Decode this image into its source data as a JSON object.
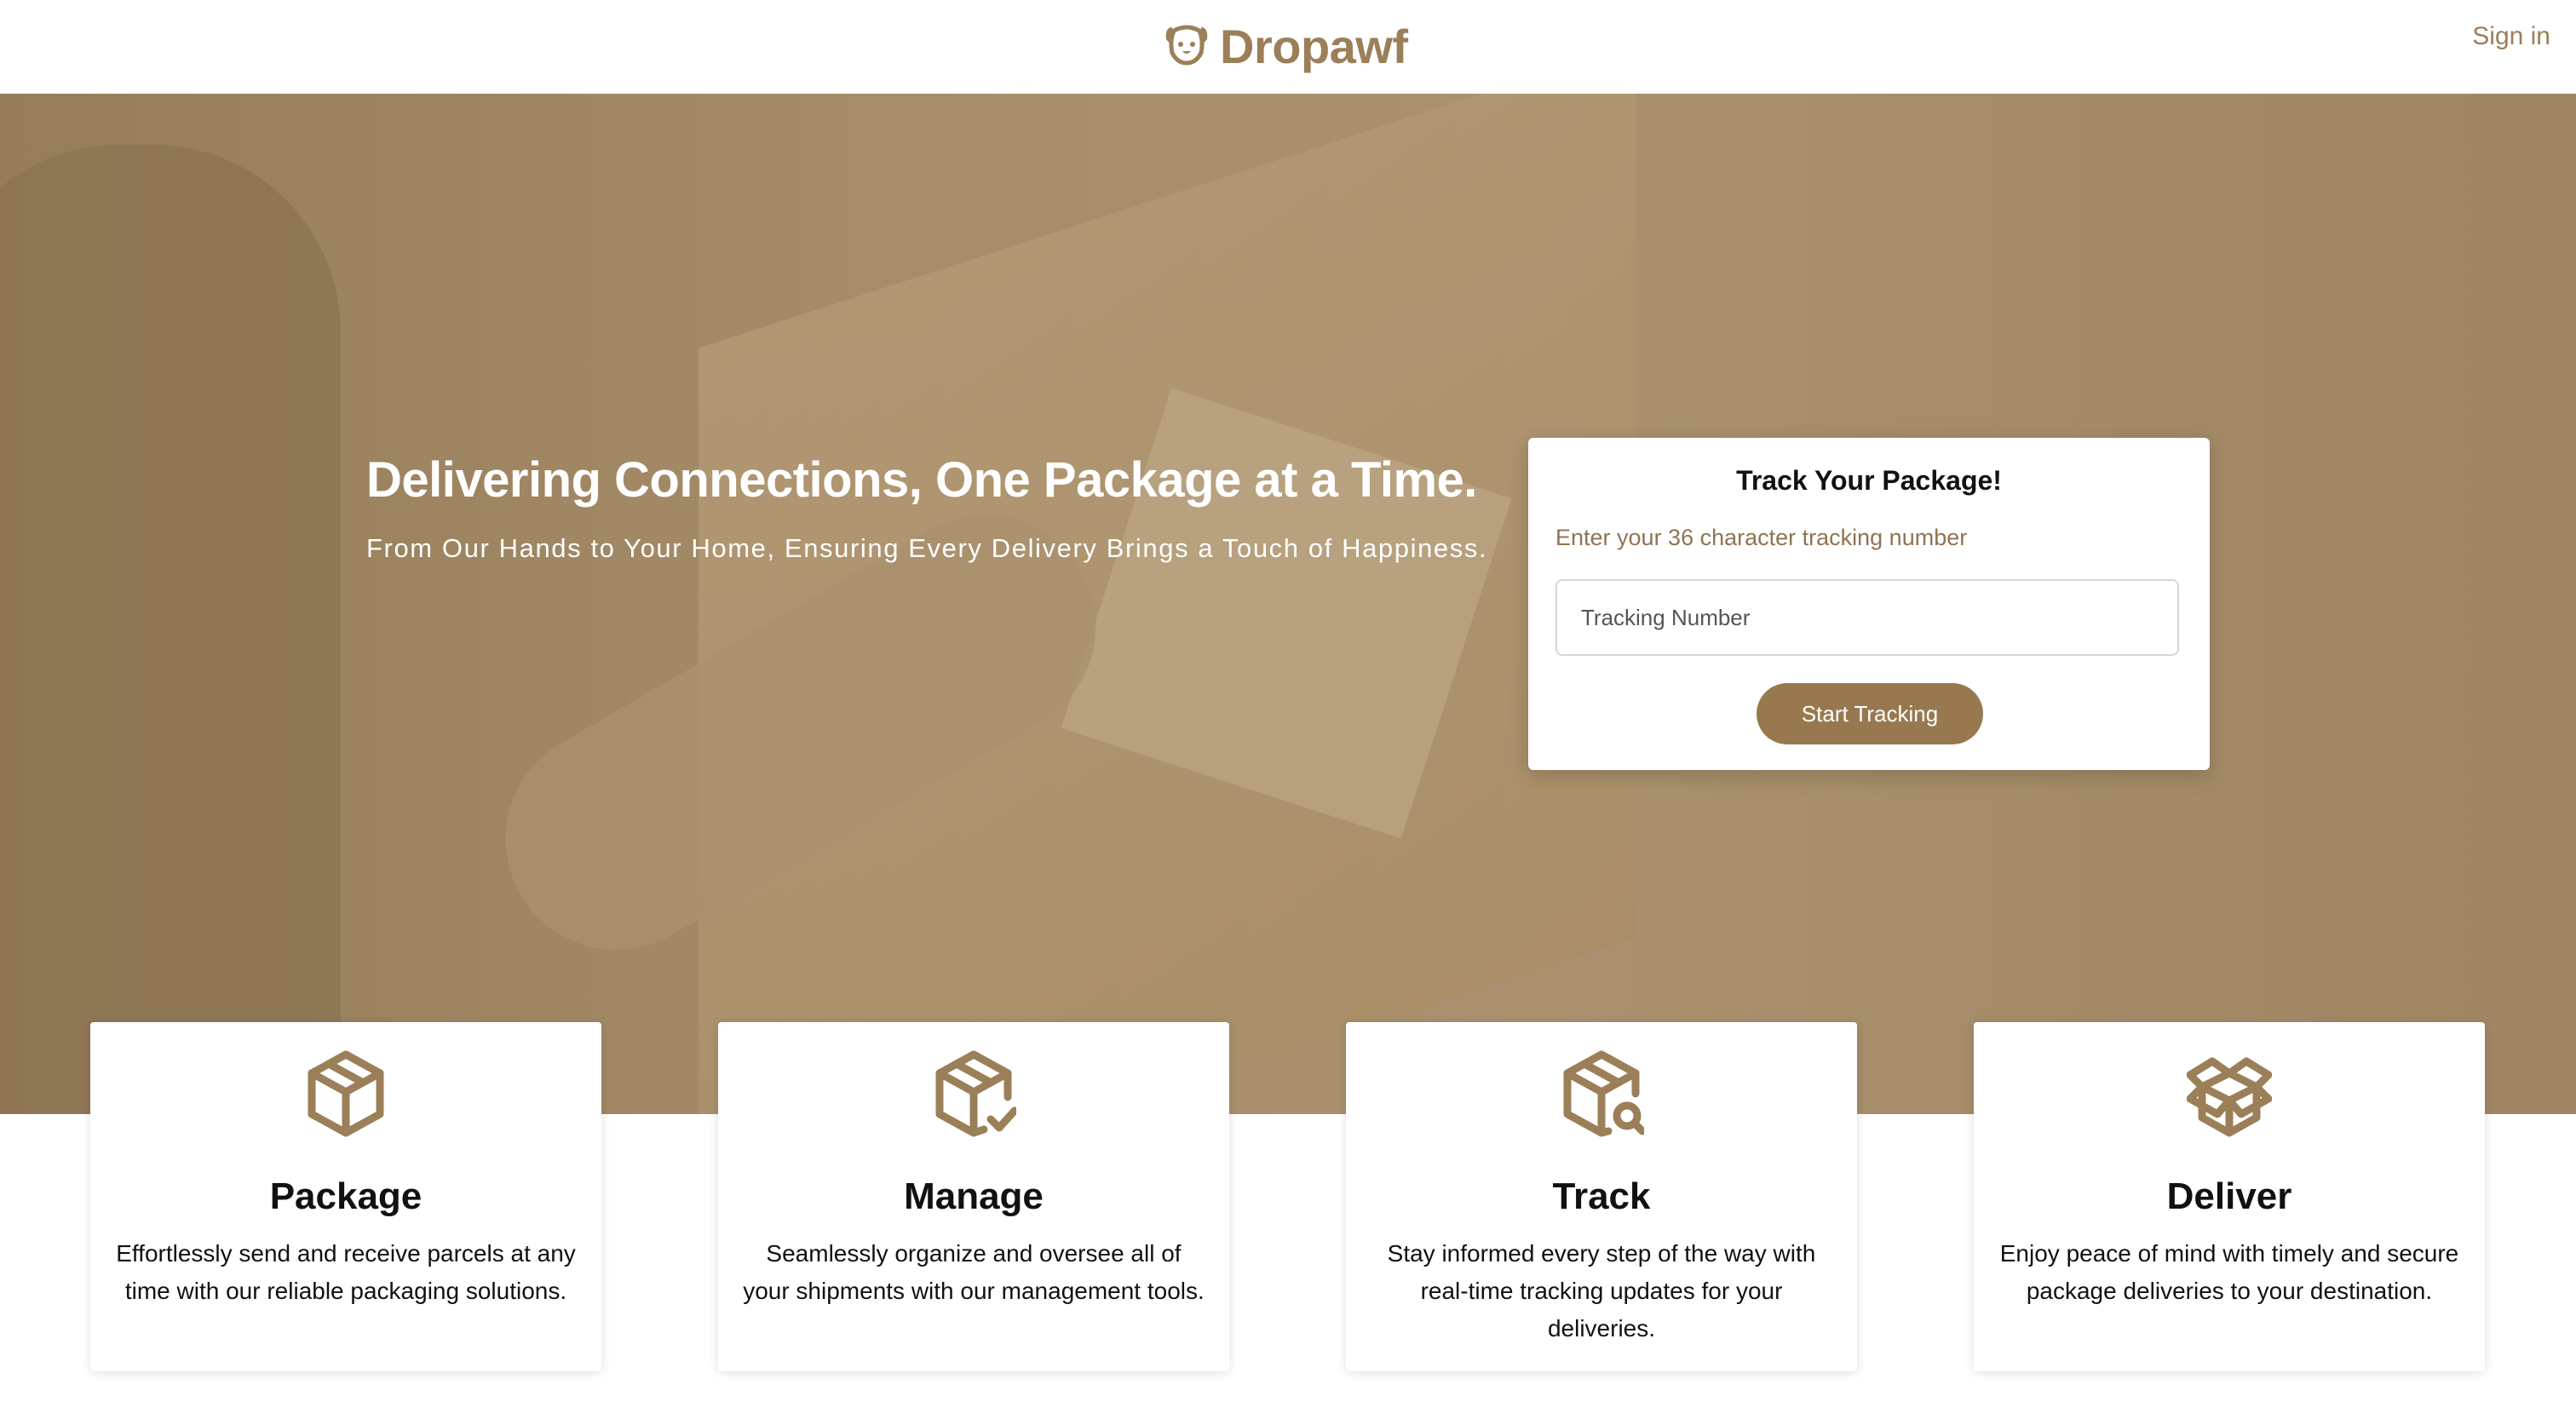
{
  "header": {
    "brand_name": "Dropawf",
    "logo_icon": "dog-face-icon",
    "signin_label": "Sign in"
  },
  "hero": {
    "title": "Delivering Connections, One Package at a Time.",
    "subtitle": "From Our Hands to Your Home, Ensuring Every Delivery Brings a Touch of Happiness."
  },
  "track": {
    "title": "Track Your Package!",
    "help": "Enter your 36 character tracking number",
    "placeholder": "Tracking Number",
    "button_label": "Start Tracking"
  },
  "features": [
    {
      "icon": "box-icon",
      "title": "Package",
      "description": "Effortlessly send and receive parcels at any time with our reliable packaging solutions."
    },
    {
      "icon": "box-check-icon",
      "title": "Manage",
      "description": "Seamlessly organize and oversee all of your shipments with our management tools."
    },
    {
      "icon": "box-search-icon",
      "title": "Track",
      "description": "Stay informed every step of the way with real-time tracking updates for your deliveries."
    },
    {
      "icon": "box-open-icon",
      "title": "Deliver",
      "description": "Enjoy peace of mind with timely and secure package deliveries to your destination."
    }
  ],
  "colors": {
    "brand": "#9b7f58",
    "button": "#98794f",
    "hero_tint": "#b39a78"
  }
}
